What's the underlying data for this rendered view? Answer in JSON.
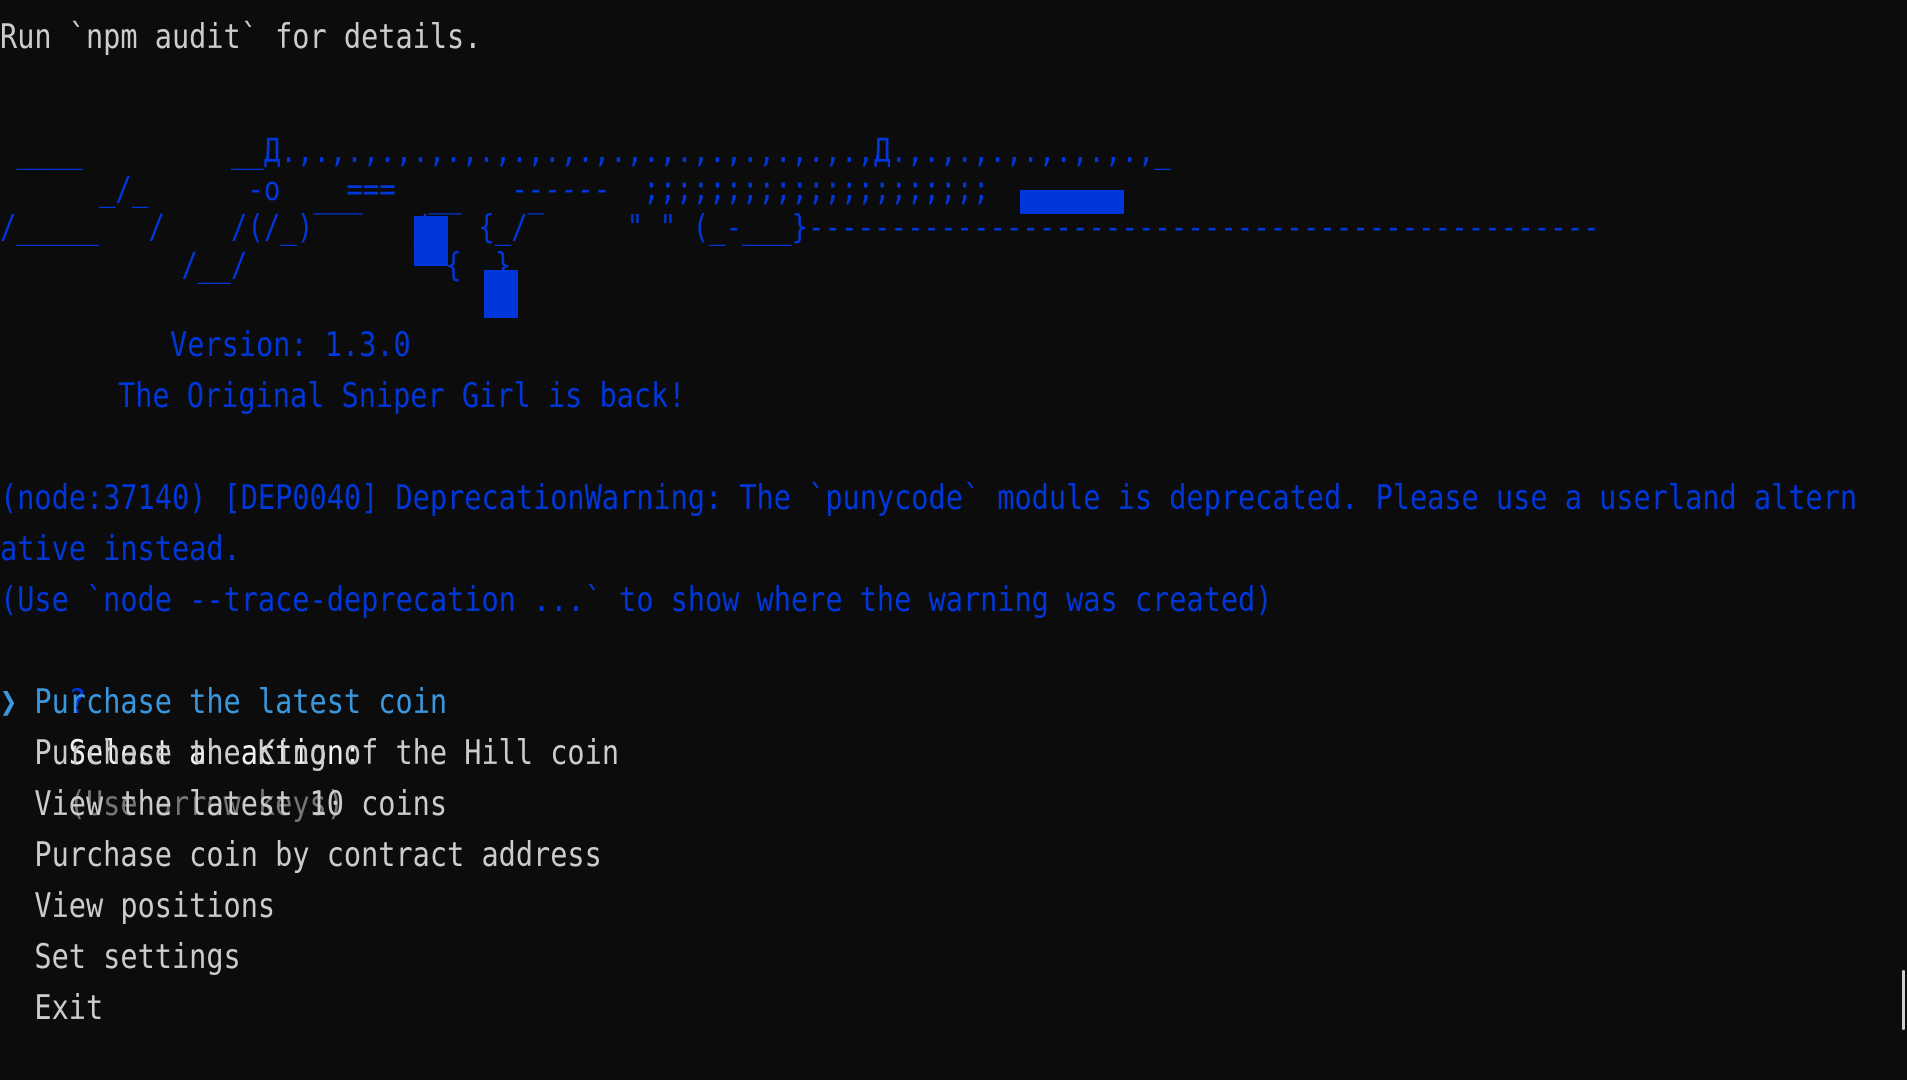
{
  "header": {
    "audit_line": "Run `npm audit` for details."
  },
  "banner": {
    "art_lines": [
      " ____         __Д.,.,.,.,.,.,.,.,.,.,.,.,.,.,.,.,.,.,Д.,.,.,.,.,.,.,.,_",
      "      _/_      -o    ===       ------  ;;;;;;;;;;;;;;;;;;;;;",
      "/_____   /    /(/_)‾‾‾   /‾‾ {_/‾     \" \" (_-___}------------------------------------------------",
      "           /__/            {  }"
    ],
    "version": "Version: 1.3.0",
    "tagline": "The Original Sniper Girl is back!"
  },
  "warnings": {
    "line1": "(node:37140) [DEP0040] DeprecationWarning: The `punycode` module is deprecated. Please use a userland altern",
    "line2": "ative instead.",
    "line3": "(Use `node --trace-deprecation ...` to show where the warning was created)"
  },
  "prompt": {
    "marker": "?",
    "question": "Select an action:",
    "hint": "(Use arrow keys)"
  },
  "menu": {
    "pointer": "❯",
    "items": [
      "Purchase the latest coin",
      "Purchase the King of the Hill coin",
      "View the latest 10 coins",
      "Purchase coin by contract address",
      "View positions",
      "Set settings",
      "Exit"
    ],
    "selected_index": 0
  },
  "colors": {
    "background": "#0c0c0c",
    "text": "#cccccc",
    "blue": "#0037da",
    "selected": "#3a96dd",
    "hint": "#767676"
  }
}
